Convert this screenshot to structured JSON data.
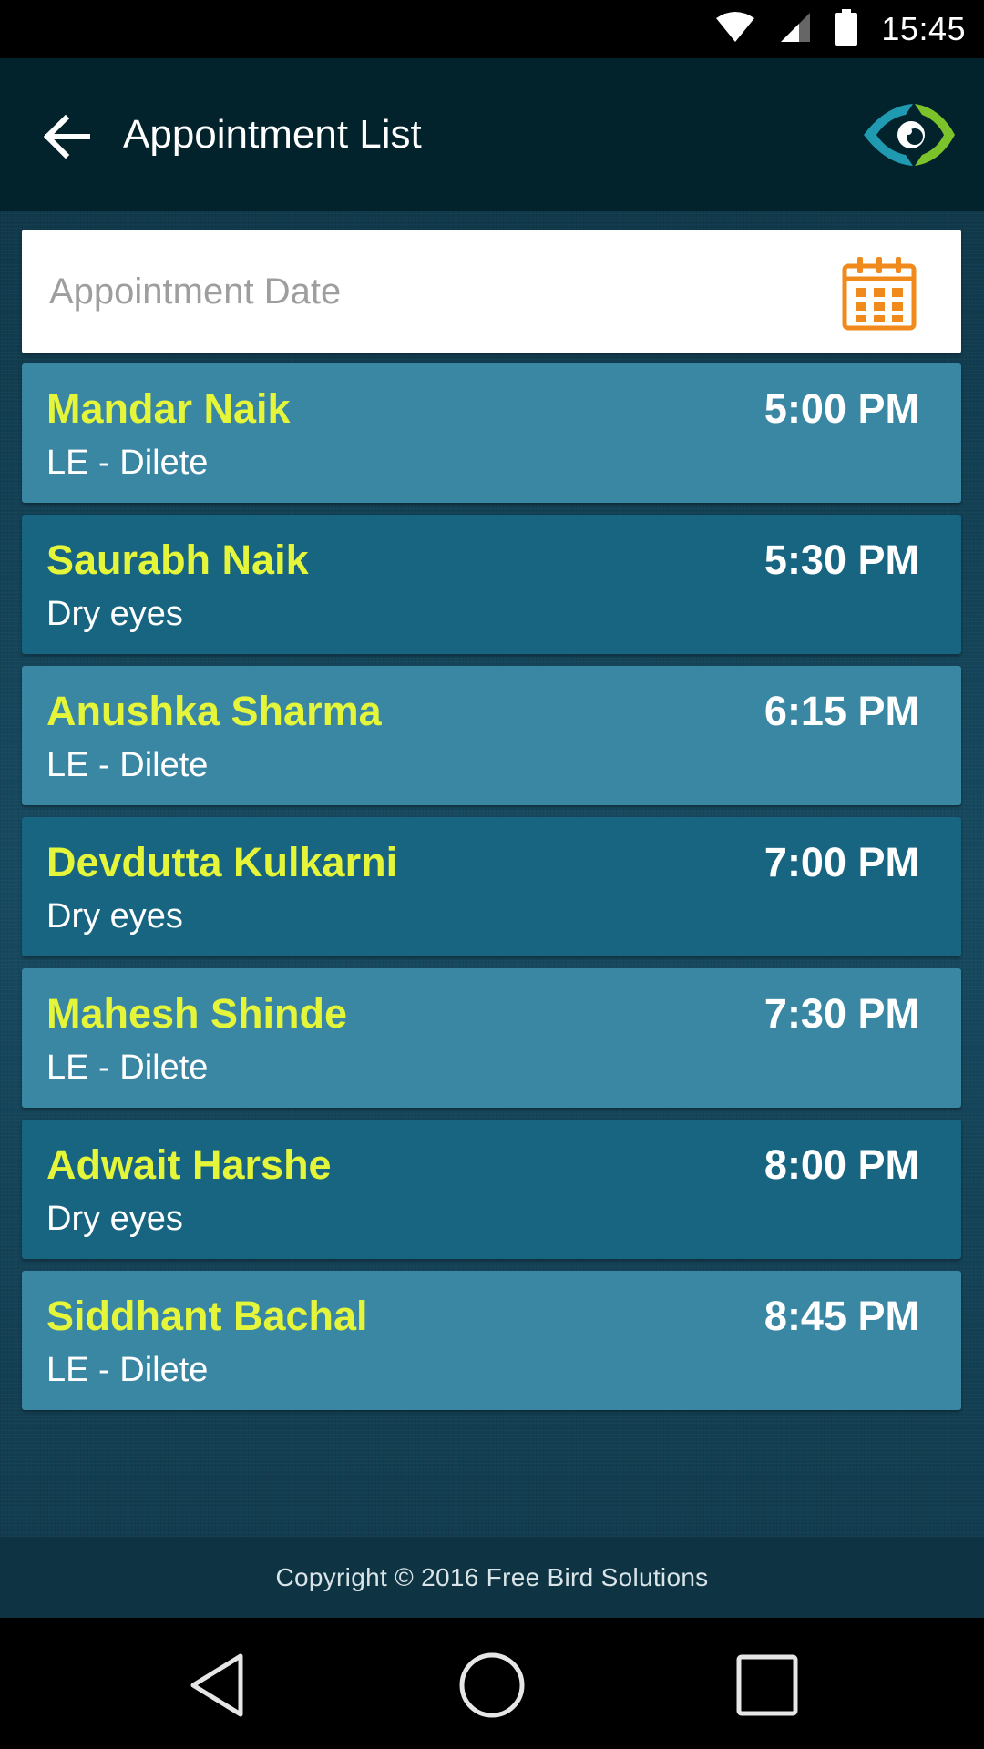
{
  "status_bar": {
    "time": "15:45",
    "icons": [
      "wifi-icon",
      "cellular-signal-icon",
      "battery-icon"
    ]
  },
  "app_bar": {
    "title": "Appointment List",
    "back_icon": "arrow-left-icon",
    "logo": "eye-logo"
  },
  "date_field": {
    "placeholder": "Appointment Date",
    "icon": "calendar-icon",
    "icon_color": "#f08a1c"
  },
  "appointments": [
    {
      "name": "Mandar Naik",
      "reason": "LE - Dilete",
      "time": "5:00 PM"
    },
    {
      "name": "Saurabh Naik",
      "reason": "Dry eyes",
      "time": "5:30 PM"
    },
    {
      "name": "Anushka Sharma",
      "reason": "LE - Dilete",
      "time": "6:15 PM"
    },
    {
      "name": "Devdutta Kulkarni",
      "reason": "Dry eyes",
      "time": "7:00 PM"
    },
    {
      "name": "Mahesh Shinde",
      "reason": "LE - Dilete",
      "time": "7:30 PM"
    },
    {
      "name": "Adwait Harshe",
      "reason": "Dry eyes",
      "time": "8:00 PM"
    },
    {
      "name": "Siddhant Bachal",
      "reason": "LE - Dilete",
      "time": "8:45 PM"
    }
  ],
  "footer": {
    "copyright": "Copyright © 2016 Free Bird Solutions"
  },
  "nav_bar": {
    "buttons": [
      "nav-back-icon",
      "nav-home-icon",
      "nav-recents-icon"
    ]
  },
  "colors": {
    "app_bar": "#02222c",
    "name_text": "#e4f53a",
    "row_light": "#3a87a3",
    "row_dark": "#176580",
    "footer": "#0e3443"
  }
}
